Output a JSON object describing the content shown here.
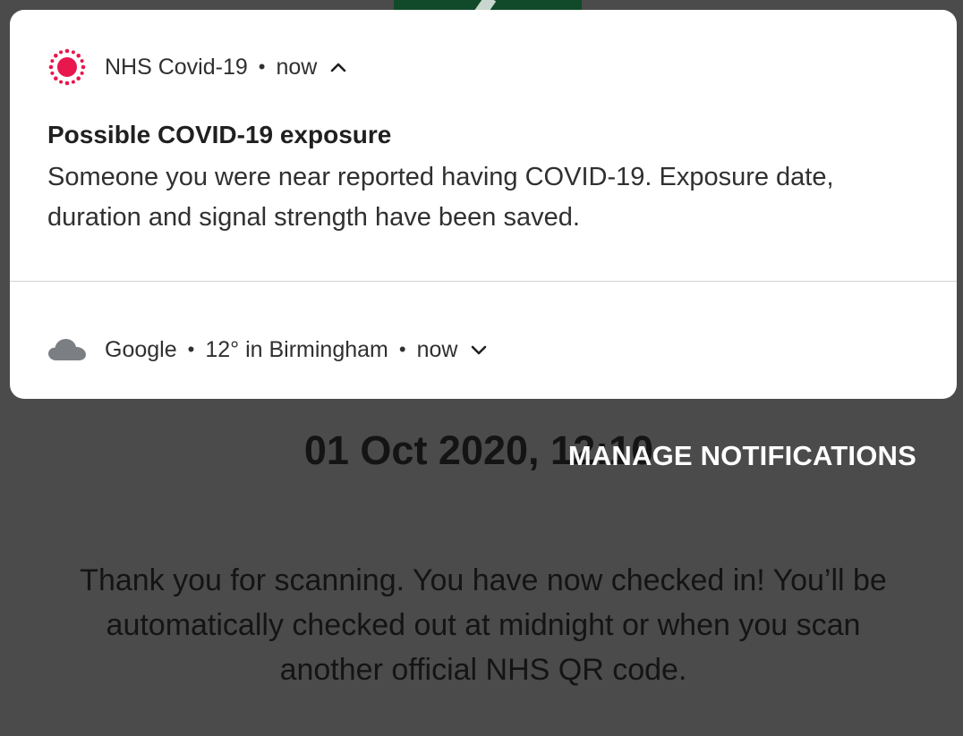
{
  "background": {
    "date_text": "01 Oct 2020, 12:10",
    "message": "Thank you for scanning. You have now checked in! You’ll be automatically checked out at midnight or when you scan another official NHS QR code."
  },
  "notifications": [
    {
      "app_name": "NHS Covid-19",
      "separator": "•",
      "time": "now",
      "icon": "covid-virus-icon",
      "expand_state": "expanded",
      "title": "Possible COVID-19 exposure",
      "body": "Someone you were near reported having COVID-19. Exposure date, duration and signal strength have been saved."
    },
    {
      "app_name": "Google",
      "separator": "•",
      "weather": "12° in Birmingham",
      "time": "now",
      "icon": "cloud-icon",
      "expand_state": "collapsed"
    }
  ],
  "manage_notifications_label": "MANAGE NOTIFICATIONS",
  "colors": {
    "scrim": "#4a4b4a",
    "card": "#ffffff",
    "nhs_icon_red": "#e8174e",
    "cloud_gray": "#7b7f83",
    "manage_text": "#ffffff"
  }
}
